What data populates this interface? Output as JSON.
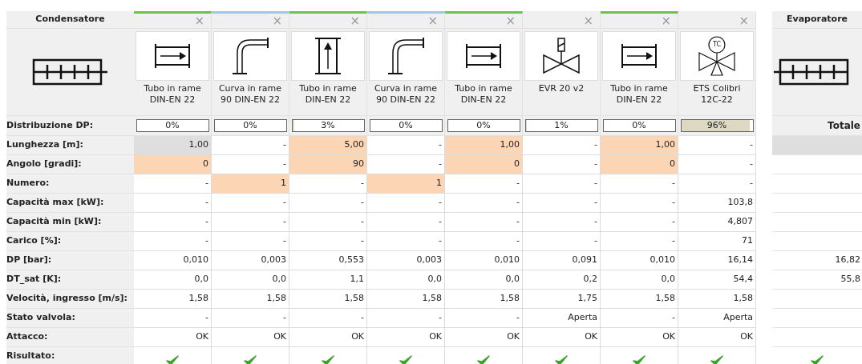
{
  "condenser": {
    "title": "Condensatore"
  },
  "components": [
    {
      "kind": "pipe",
      "name": [
        "Tubo in rame",
        "DIN-EN 22"
      ],
      "color": "#6cc24a",
      "close": "×",
      "dp": {
        "label": "0%",
        "level": 0
      }
    },
    {
      "kind": "bend",
      "name": [
        "Curva in rame",
        "90 DIN-EN 22"
      ],
      "color": "#a9c3e6",
      "close": "×",
      "dp": {
        "label": "0%",
        "level": 0
      }
    },
    {
      "kind": "pipe_up",
      "name": [
        "Tubo in rame",
        "DIN-EN 22"
      ],
      "color": "#6cc24a",
      "close": "×",
      "dp": {
        "label": "3%",
        "level": 0.03
      }
    },
    {
      "kind": "bend",
      "name": [
        "Curva in rame",
        "90 DIN-EN 22"
      ],
      "color": "#a9c3e6",
      "close": "×",
      "dp": {
        "label": "0%",
        "level": 0
      }
    },
    {
      "kind": "pipe",
      "name": [
        "Tubo in rame",
        "DIN-EN 22"
      ],
      "color": "#6cc24a",
      "close": "×",
      "dp": {
        "label": "0%",
        "level": 0
      }
    },
    {
      "kind": "solenoid_valve",
      "name": [
        "EVR 20 v2"
      ],
      "close": "×",
      "dp": {
        "label": "1%",
        "level": 0.01
      }
    },
    {
      "kind": "pipe",
      "name": [
        "Tubo in rame",
        "DIN-EN 22"
      ],
      "color": "#6cc24a",
      "close": "×",
      "dp": {
        "label": "0%",
        "level": 0
      }
    },
    {
      "kind": "tc_valve",
      "icon_label": "TC",
      "name": [
        "ETS Colibri",
        "12C-22"
      ],
      "close": "×",
      "dp": {
        "label": "96%",
        "level": 0.96
      }
    }
  ],
  "dp_row_label": "Distribuzione DP:",
  "evaporator": {
    "title": "Evaporatore",
    "dp_label": "Totale"
  },
  "rows": [
    {
      "kind": "text",
      "label": "Lunghezza [m]:",
      "cells": [
        {
          "value": "1,00",
          "editable": true,
          "selected": true
        },
        {
          "value": "-",
          "editable": false,
          "selected": false
        },
        {
          "value": "5,00",
          "editable": true,
          "selected": false
        },
        {
          "value": "-",
          "editable": false,
          "selected": false
        },
        {
          "value": "1,00",
          "editable": true,
          "selected": false
        },
        {
          "value": "-",
          "editable": false,
          "selected": false
        },
        {
          "value": "1,00",
          "editable": true,
          "selected": false
        },
        {
          "value": "-",
          "editable": false,
          "selected": false
        }
      ],
      "total": {
        "selected": true
      }
    },
    {
      "kind": "text",
      "label": "Angolo [gradi]:",
      "cells": [
        {
          "value": "0",
          "editable": true,
          "selected": false
        },
        {
          "value": "-",
          "editable": false,
          "selected": false
        },
        {
          "value": "90",
          "editable": true,
          "selected": false
        },
        {
          "value": "-",
          "editable": false,
          "selected": false
        },
        {
          "value": "0",
          "editable": true,
          "selected": false
        },
        {
          "value": "-",
          "editable": false,
          "selected": false
        },
        {
          "value": "0",
          "editable": true,
          "selected": false
        },
        {
          "value": "-",
          "editable": false,
          "selected": false
        }
      ],
      "total": {
        "selected": false
      }
    },
    {
      "kind": "text",
      "label": "Numero:",
      "cells": [
        {
          "value": "-",
          "editable": false,
          "selected": false
        },
        {
          "value": "1",
          "editable": true,
          "selected": false
        },
        {
          "value": "-",
          "editable": false,
          "selected": false
        },
        {
          "value": "1",
          "editable": true,
          "selected": false
        },
        {
          "value": "-",
          "editable": false,
          "selected": false
        },
        {
          "value": "-",
          "editable": false,
          "selected": false
        },
        {
          "value": "-",
          "editable": false,
          "selected": false
        },
        {
          "value": "-",
          "editable": false,
          "selected": false
        }
      ],
      "total": {
        "selected": false
      }
    },
    {
      "kind": "text",
      "label": "Capacità max [kW]:",
      "cells": [
        {
          "value": "-",
          "editable": false,
          "selected": false
        },
        {
          "value": "-",
          "editable": false,
          "selected": false
        },
        {
          "value": "-",
          "editable": false,
          "selected": false
        },
        {
          "value": "-",
          "editable": false,
          "selected": false
        },
        {
          "value": "-",
          "editable": false,
          "selected": false
        },
        {
          "value": "-",
          "editable": false,
          "selected": false
        },
        {
          "value": "-",
          "editable": false,
          "selected": false
        },
        {
          "value": "103,8",
          "editable": false,
          "selected": false
        }
      ],
      "total": {
        "selected": false
      }
    },
    {
      "kind": "text",
      "label": "Capacità min [kW]:",
      "cells": [
        {
          "value": "-",
          "editable": false,
          "selected": false
        },
        {
          "value": "-",
          "editable": false,
          "selected": false
        },
        {
          "value": "-",
          "editable": false,
          "selected": false
        },
        {
          "value": "-",
          "editable": false,
          "selected": false
        },
        {
          "value": "-",
          "editable": false,
          "selected": false
        },
        {
          "value": "-",
          "editable": false,
          "selected": false
        },
        {
          "value": "-",
          "editable": false,
          "selected": false
        },
        {
          "value": "4,807",
          "editable": false,
          "selected": false
        }
      ],
      "total": {
        "selected": false
      }
    },
    {
      "kind": "text",
      "label": "Carico [%]:",
      "cells": [
        {
          "value": "-",
          "editable": false,
          "selected": false
        },
        {
          "value": "-",
          "editable": false,
          "selected": false
        },
        {
          "value": "-",
          "editable": false,
          "selected": false
        },
        {
          "value": "-",
          "editable": false,
          "selected": false
        },
        {
          "value": "-",
          "editable": false,
          "selected": false
        },
        {
          "value": "-",
          "editable": false,
          "selected": false
        },
        {
          "value": "-",
          "editable": false,
          "selected": false
        },
        {
          "value": "71",
          "editable": false,
          "selected": false
        }
      ],
      "total": {
        "selected": false
      }
    },
    {
      "kind": "text",
      "label": "DP [bar]:",
      "cells": [
        {
          "value": "0,010",
          "editable": false,
          "selected": false
        },
        {
          "value": "0,003",
          "editable": false,
          "selected": false
        },
        {
          "value": "0,553",
          "editable": false,
          "selected": false
        },
        {
          "value": "0,003",
          "editable": false,
          "selected": false
        },
        {
          "value": "0,010",
          "editable": false,
          "selected": false
        },
        {
          "value": "0,091",
          "editable": false,
          "selected": false
        },
        {
          "value": "0,010",
          "editable": false,
          "selected": false
        },
        {
          "value": "16,14",
          "editable": false,
          "selected": false
        }
      ],
      "total": {
        "value": "16,82",
        "selected": false
      }
    },
    {
      "kind": "text",
      "label": "DT_sat [K]:",
      "cells": [
        {
          "value": "0,0",
          "editable": false,
          "selected": false
        },
        {
          "value": "0,0",
          "editable": false,
          "selected": false
        },
        {
          "value": "1,1",
          "editable": false,
          "selected": false
        },
        {
          "value": "0,0",
          "editable": false,
          "selected": false
        },
        {
          "value": "0,0",
          "editable": false,
          "selected": false
        },
        {
          "value": "0,2",
          "editable": false,
          "selected": false
        },
        {
          "value": "0,0",
          "editable": false,
          "selected": false
        },
        {
          "value": "54,4",
          "editable": false,
          "selected": false
        }
      ],
      "total": {
        "value": "55,8",
        "selected": false
      }
    },
    {
      "kind": "text",
      "label": "Velocità, ingresso [m/s]:",
      "cells": [
        {
          "value": "1,58",
          "editable": false,
          "selected": false
        },
        {
          "value": "1,58",
          "editable": false,
          "selected": false
        },
        {
          "value": "1,58",
          "editable": false,
          "selected": false
        },
        {
          "value": "1,58",
          "editable": false,
          "selected": false
        },
        {
          "value": "1,58",
          "editable": false,
          "selected": false
        },
        {
          "value": "1,75",
          "editable": false,
          "selected": false
        },
        {
          "value": "1,58",
          "editable": false,
          "selected": false
        },
        {
          "value": "1,58",
          "editable": false,
          "selected": false
        }
      ],
      "total": {
        "selected": false
      }
    },
    {
      "kind": "text",
      "label": "Stato valvola:",
      "cells": [
        {
          "value": "-",
          "editable": false,
          "selected": false
        },
        {
          "value": "-",
          "editable": false,
          "selected": false
        },
        {
          "value": "-",
          "editable": false,
          "selected": false
        },
        {
          "value": "-",
          "editable": false,
          "selected": false
        },
        {
          "value": "-",
          "editable": false,
          "selected": false
        },
        {
          "value": "Aperta",
          "editable": false,
          "selected": false
        },
        {
          "value": "-",
          "editable": false,
          "selected": false
        },
        {
          "value": "Aperta",
          "editable": false,
          "selected": false
        }
      ],
      "total": {
        "selected": false
      }
    },
    {
      "kind": "text",
      "label": "Attacco:",
      "cells": [
        {
          "value": "OK",
          "editable": false,
          "selected": false
        },
        {
          "value": "OK",
          "editable": false,
          "selected": false
        },
        {
          "value": "OK",
          "editable": false,
          "selected": false
        },
        {
          "value": "OK",
          "editable": false,
          "selected": false
        },
        {
          "value": "OK",
          "editable": false,
          "selected": false
        },
        {
          "value": "OK",
          "editable": false,
          "selected": false
        },
        {
          "value": "OK",
          "editable": false,
          "selected": false
        },
        {
          "value": "OK",
          "editable": false,
          "selected": false
        }
      ],
      "total": {
        "selected": false
      }
    },
    {
      "kind": "check",
      "label": "Risultato:",
      "cells": [
        {
          "passed": true
        },
        {
          "passed": true
        },
        {
          "passed": true
        },
        {
          "passed": true
        },
        {
          "passed": true
        },
        {
          "passed": true
        },
        {
          "passed": true
        },
        {
          "passed": true
        }
      ],
      "total": {
        "passed": true
      }
    }
  ]
}
